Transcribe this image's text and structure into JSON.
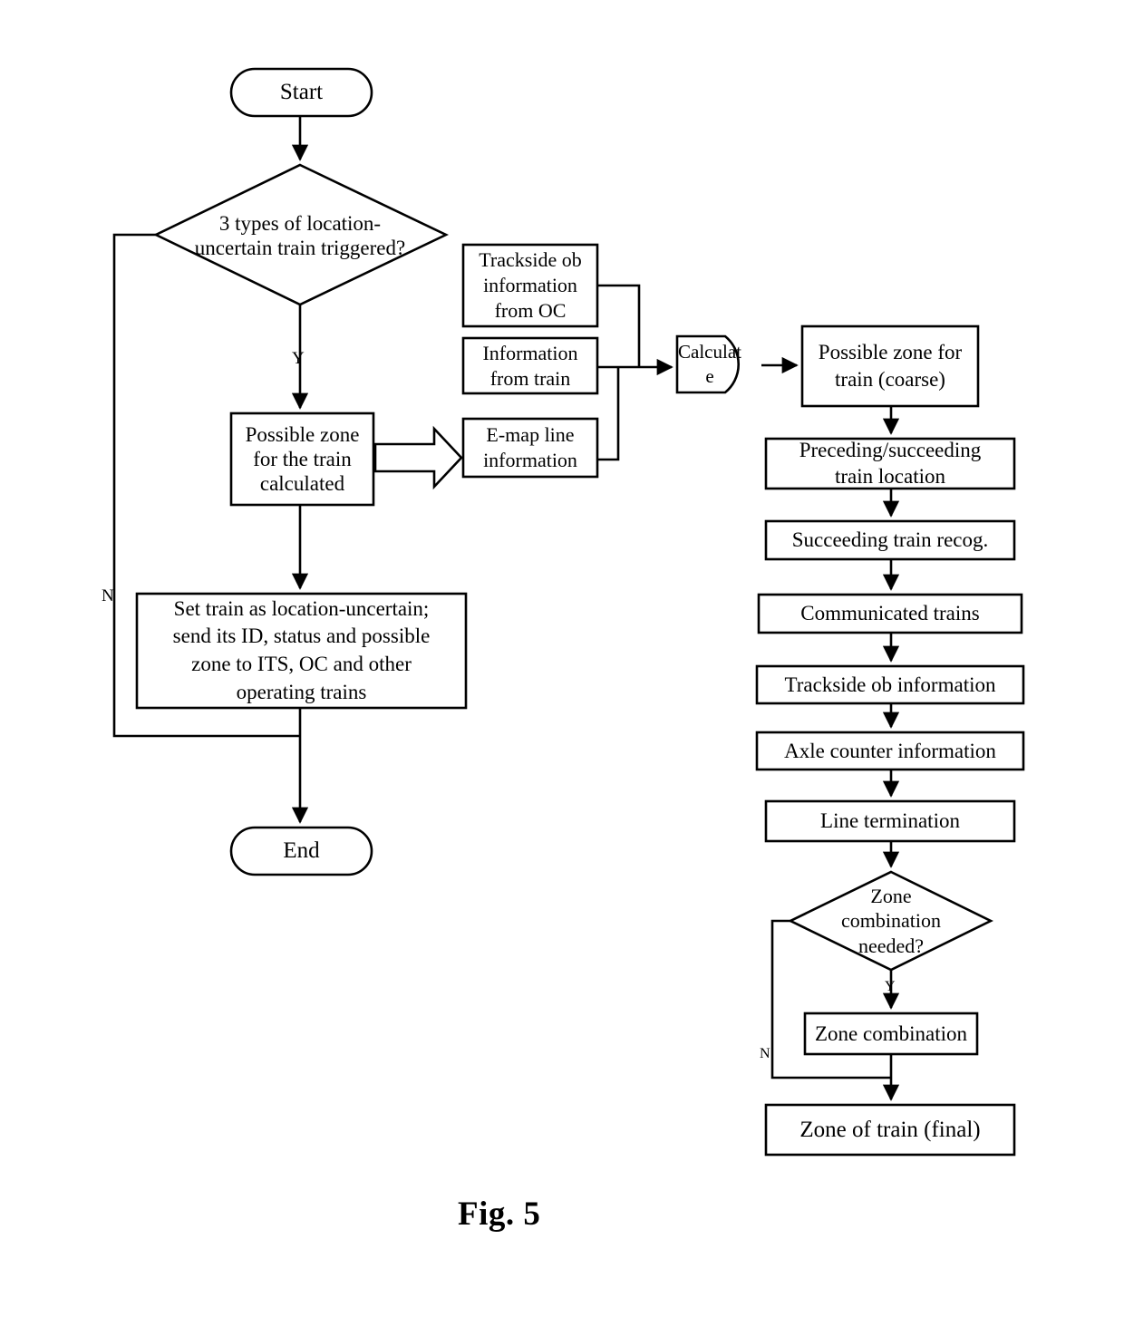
{
  "figure": {
    "caption": "Fig. 5"
  },
  "nodes": {
    "start": {
      "label": "Start",
      "shape": "terminator"
    },
    "decision_types": {
      "label": "3 types of location-\nuncertain train triggered?",
      "shape": "decision"
    },
    "possible_zone_calculated": {
      "label": "Possible zone\nfor the train\ncalculated",
      "shape": "process"
    },
    "set_train_uncertain": {
      "label": "Set train as location-uncertain;\nsend its ID, status and possible\nzone to ITS, OC and other\noperating trains",
      "shape": "process"
    },
    "end": {
      "label": "End",
      "shape": "terminator"
    },
    "trackside_ob_from_oc": {
      "label": "Trackside ob\ninformation\nfrom OC",
      "shape": "process"
    },
    "information_from_train": {
      "label": "Information\nfrom train",
      "shape": "process"
    },
    "emap_line_information": {
      "label": "E-map line\ninformation",
      "shape": "process"
    },
    "calculate": {
      "label": "Calculat\ne",
      "shape": "d-shape"
    },
    "possible_zone_coarse": {
      "label": "Possible zone  for\ntrain (coarse)",
      "shape": "process"
    },
    "preceding_succeeding": {
      "label": "Preceding/succeeding\ntrain location",
      "shape": "process"
    },
    "succeeding_train_recog": {
      "label": "Succeeding train recog.",
      "shape": "process"
    },
    "communicated_trains": {
      "label": "Communicated trains",
      "shape": "process"
    },
    "trackside_ob_information": {
      "label": "Trackside ob information",
      "shape": "process"
    },
    "axle_counter_information": {
      "label": "Axle counter information",
      "shape": "process"
    },
    "line_termination": {
      "label": "Line termination",
      "shape": "process"
    },
    "decision_zone_combination": {
      "label": "Zone\ncombination\nneeded?",
      "shape": "decision"
    },
    "zone_combination": {
      "label": "Zone combination",
      "shape": "process"
    },
    "zone_of_train_final": {
      "label": "Zone of train (final)",
      "shape": "process"
    }
  },
  "edge_labels": {
    "decision_types_yes": "Y",
    "decision_types_no": "N",
    "zone_combination_yes": "Y",
    "zone_combination_no": "N"
  },
  "colors": {
    "stroke": "#000000",
    "fill": "#ffffff",
    "text": "#000000"
  }
}
